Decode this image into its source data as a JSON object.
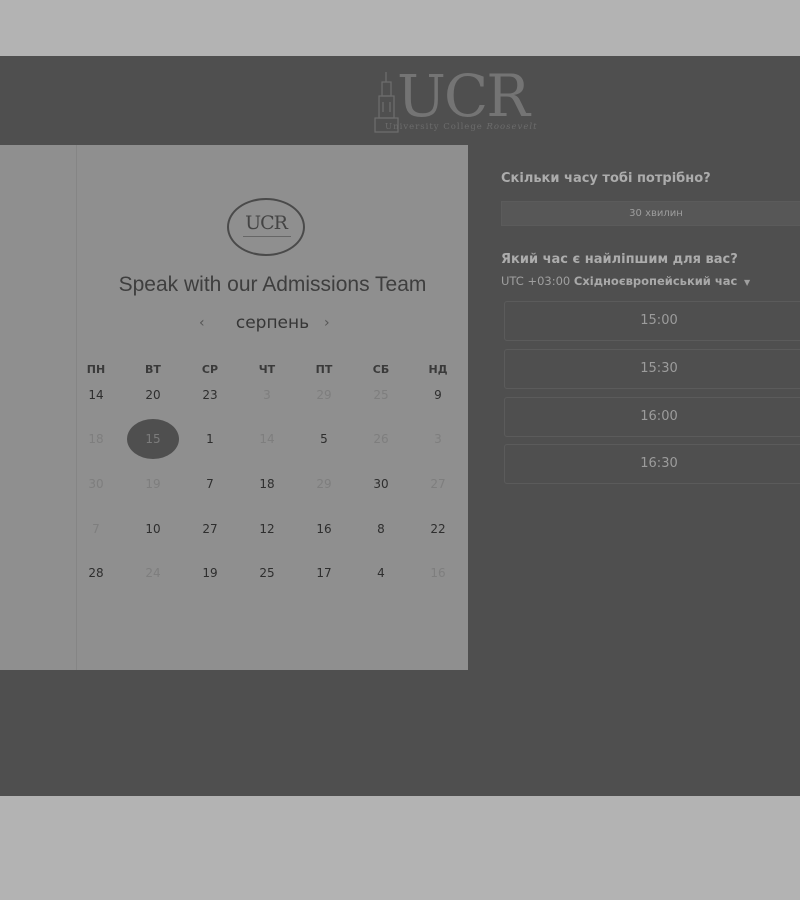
{
  "header": {
    "logo_text": "UCR",
    "logo_subtitle_plain": "University College",
    "logo_subtitle_italic": "Roosevelt"
  },
  "booking_card": {
    "logo_text": "UCR",
    "title": "Speak with our Admissions Team",
    "month": "серпень",
    "prev_icon": "‹",
    "next_icon": "›",
    "weekdays": [
      "ПН",
      "ВТ",
      "СР",
      "ЧТ",
      "ПТ",
      "СБ",
      "НД"
    ],
    "weeks": [
      [
        {
          "d": "14",
          "s": "available"
        },
        {
          "d": "20",
          "s": "available"
        },
        {
          "d": "23",
          "s": "available"
        },
        {
          "d": "3",
          "s": "disabled"
        },
        {
          "d": "29",
          "s": "disabled"
        },
        {
          "d": "25",
          "s": "disabled"
        },
        {
          "d": "9",
          "s": "available"
        }
      ],
      [
        {
          "d": "18",
          "s": "disabled"
        },
        {
          "d": "15",
          "s": "selected"
        },
        {
          "d": "1",
          "s": "available"
        },
        {
          "d": "14",
          "s": "disabled"
        },
        {
          "d": "5",
          "s": "available"
        },
        {
          "d": "26",
          "s": "disabled"
        },
        {
          "d": "3",
          "s": "disabled"
        }
      ],
      [
        {
          "d": "30",
          "s": "disabled"
        },
        {
          "d": "19",
          "s": "disabled"
        },
        {
          "d": "7",
          "s": "available"
        },
        {
          "d": "18",
          "s": "available"
        },
        {
          "d": "29",
          "s": "disabled"
        },
        {
          "d": "30",
          "s": "available"
        },
        {
          "d": "27",
          "s": "disabled"
        }
      ],
      [
        {
          "d": "7",
          "s": "disabled"
        },
        {
          "d": "10",
          "s": "available"
        },
        {
          "d": "27",
          "s": "available"
        },
        {
          "d": "12",
          "s": "available"
        },
        {
          "d": "16",
          "s": "available"
        },
        {
          "d": "8",
          "s": "available"
        },
        {
          "d": "22",
          "s": "available"
        }
      ],
      [
        {
          "d": "28",
          "s": "available"
        },
        {
          "d": "24",
          "s": "disabled"
        },
        {
          "d": "19",
          "s": "available"
        },
        {
          "d": "25",
          "s": "available"
        },
        {
          "d": "17",
          "s": "available"
        },
        {
          "d": "4",
          "s": "available"
        },
        {
          "d": "16",
          "s": "disabled"
        }
      ]
    ]
  },
  "scheduler": {
    "duration_question": "Скільки часу тобі потрібно?",
    "duration_value": "30 хвилин",
    "time_question": "Який час є найліпшим для вас?",
    "timezone_offset": "UTC +03:00",
    "timezone_name": "Східноєвропейський час",
    "timezone_caret": "▼",
    "slots": [
      "15:00",
      "15:30",
      "16:00",
      "16:30"
    ]
  }
}
